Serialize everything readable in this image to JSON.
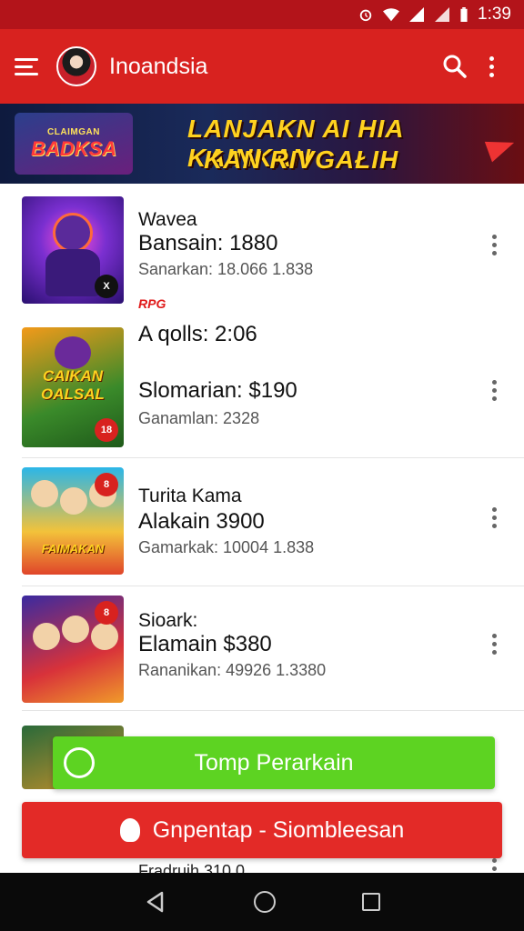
{
  "status_bar": {
    "time": "1:39",
    "icons": [
      "alarm-icon",
      "wifi-icon",
      "signal-icon",
      "signal-icon",
      "battery-icon"
    ]
  },
  "app_bar": {
    "title": "Inoandsia",
    "icons": [
      "menu-icon",
      "avatar",
      "search-icon",
      "more-vert-icon"
    ]
  },
  "banner": {
    "logo_small": "CLAIMGAN",
    "logo_big": "BADKSA",
    "line1": "LANJAKN AI HIA KAINKAN",
    "line2": "KAN RIVGAŁIH"
  },
  "games": [
    {
      "name": "Wavea",
      "price": "Bansain: 1880",
      "sub": "Sanarkan:  18.066  1.838",
      "badge": "X"
    },
    {
      "name": "A qolls: 2:06",
      "price": "Slomarian: $190",
      "sub": "Ganamlan:  2328",
      "badge": "18",
      "tag": "RPG",
      "thumb_text": "CAIKAN OALSAL"
    },
    {
      "name": "Turita Kama",
      "price": "Alakain  3900",
      "sub": "Gamarkak:  10004  1.838",
      "badge": "8",
      "thumb_text": "FAIMAKAN"
    },
    {
      "name": "Sioark:",
      "price": "Elamain  $380",
      "sub": "Rananikan:  49926  1.3380",
      "badge": "8"
    }
  ],
  "buttons": {
    "green": "Tomp Perarkain",
    "red": "Gnpentap - Siombleesan"
  },
  "peek": "Fradruih  310 0",
  "colors": {
    "primary": "#d8221f",
    "status": "#b3141a",
    "green": "#5dd322",
    "red_button": "#e32a27"
  },
  "nav_bar": [
    "back-icon",
    "home-icon",
    "recents-icon"
  ]
}
